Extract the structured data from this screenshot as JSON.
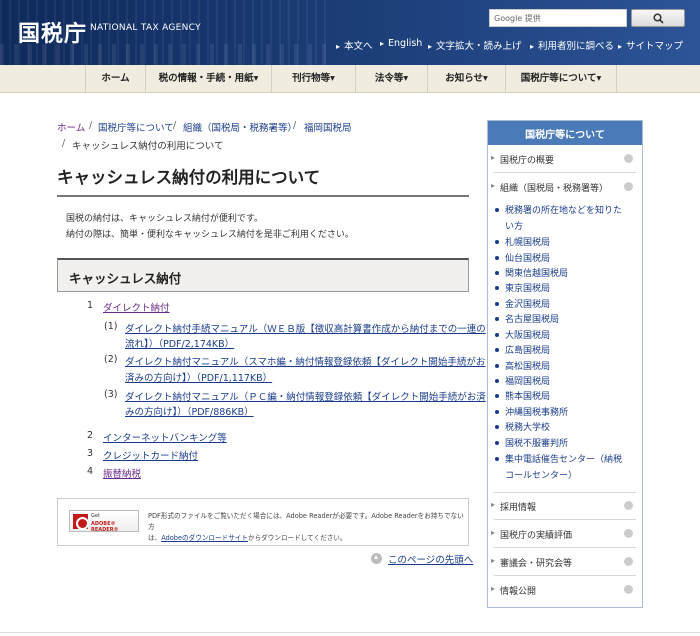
{
  "header": {
    "logo_ja": "国税庁",
    "logo_en": "NATIONAL TAX AGENCY",
    "search_placeholder": "Google 提供",
    "utility_links": [
      "本文へ",
      "English",
      "文字拡大・読み上げ",
      "利用者別に調べる",
      "サイトマップ"
    ]
  },
  "nav": [
    "ホーム",
    "税の情報・手続・用紙▾",
    "刊行物等▾",
    "法令等▾",
    "お知らせ▾",
    "国税庁等について▾"
  ],
  "breadcrumb": {
    "items": [
      "ホーム",
      "国税庁等について",
      "組織（国税局・税務署等）",
      "福岡国税局"
    ],
    "current": "キャッシュレス納付の利用について"
  },
  "page_title": "キャッシュレス納付の利用について",
  "intro": [
    "国税の納付は、キャッシュレス納付が便利です。",
    "納付の際は、簡単・便利なキャッシュレス納付を是非ご利用ください。"
  ],
  "section_title": "キャッシュレス納付",
  "items": [
    {
      "num": "1",
      "label": "ダイレクト納付"
    },
    {
      "num": "2",
      "label": "インターネットバンキング等"
    },
    {
      "num": "3",
      "label": "クレジットカード納付"
    },
    {
      "num": "4",
      "label": "振替納税"
    }
  ],
  "subitems": [
    {
      "num": "(1)",
      "line1": "ダイレクト納付手続マニュアル（ＷＥＢ版【徴収高計算書作成から納付までの一連の",
      "line2": "流れ】）（PDF/2,174KB）"
    },
    {
      "num": "(2)",
      "line1": "ダイレクト納付マニュアル（スマホ編・納付情報登録依頼【ダイレクト開始手続がお",
      "line2": "済みの方向け】）（PDF/1,117KB）"
    },
    {
      "num": "(3)",
      "line1": "ダイレクト納付マニュアル（ＰＣ編・納付情報登録依頼【ダイレクト開始手続がお済",
      "line2": "みの方向け】）（PDF/886KB）"
    }
  ],
  "adobe": {
    "badge_get": "Get",
    "badge_reader": "ADOBE® READER®",
    "text_line1": "PDF形式のファイルをご覧いただく場合には、Adobe Readerが必要です。Adobe Readerをお持ちでない方",
    "text_pre": "は、",
    "text_link": "Adobeのダウンロードサイト",
    "text_post": "からダウンロードしてください。"
  },
  "pagetop": "このページの先頭へ",
  "sidebar": {
    "title": "国税庁等について",
    "overview": "国税庁の概要",
    "org": "組織（国税局・税務署等）",
    "sub_first_line1": "税務署の所在地などを知りた",
    "sub_first_line2": "い方",
    "sub": [
      "札幌国税局",
      "仙台国税局",
      "関東信越国税局",
      "東京国税局",
      "金沢国税局",
      "名古屋国税局",
      "大阪国税局",
      "広島国税局",
      "高松国税局",
      "福岡国税局",
      "熊本国税局",
      "沖縄国税事務所",
      "税務大学校",
      "国税不服審判所"
    ],
    "sub_last_line1": "集中電話催告センター（納税",
    "sub_last_line2": "コールセンター）",
    "bottom": [
      "採用情報",
      "国税庁の実績評価",
      "審議会・研究会等",
      "情報公開"
    ]
  }
}
